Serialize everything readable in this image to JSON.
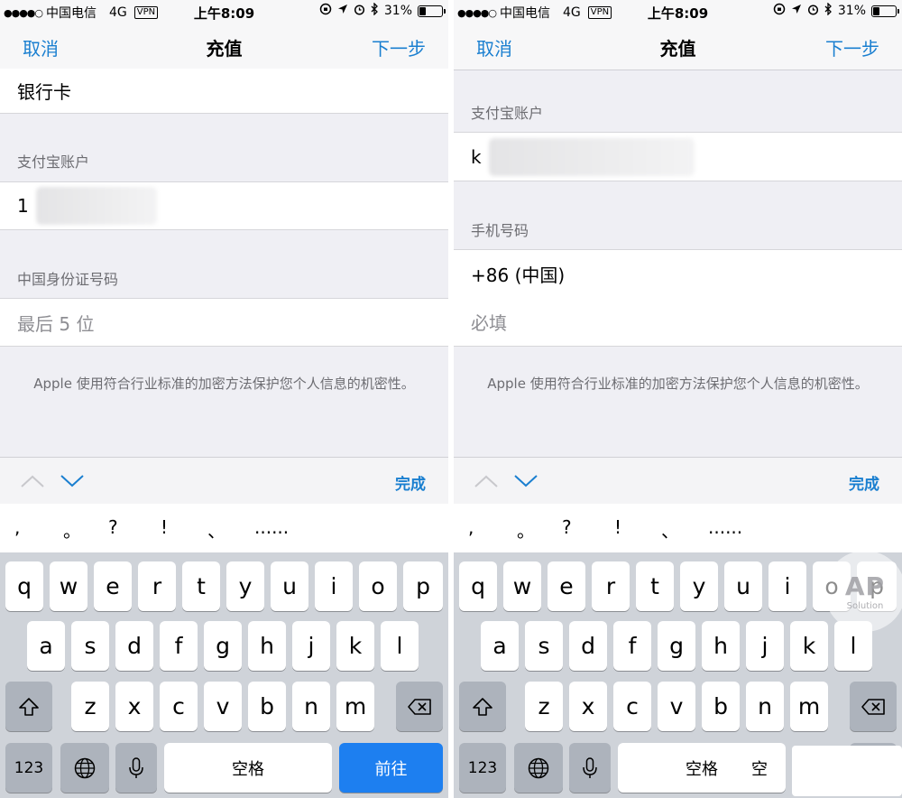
{
  "status": {
    "dots": "●●●●○",
    "carrier": "中国电信",
    "network": "4G",
    "vpn": "VPN",
    "time": "上午8:09",
    "icons": [
      "orientation-lock-icon",
      "location-icon",
      "alarm-icon",
      "bluetooth-icon"
    ],
    "battery": "31%",
    "battery_level": 0.31
  },
  "nav": {
    "cancel": "取消",
    "title": "充值",
    "next": "下一步"
  },
  "left": {
    "bank_card": "银行卡",
    "alipay_label": "支付宝账户",
    "alipay_value_prefix": "1",
    "id_label": "中国身份证号码",
    "id_placeholder": "最后 5 位",
    "note": "Apple 使用符合行业标准的加密方法保护您个人信息的机密性。"
  },
  "right": {
    "alipay_label": "支付宝账户",
    "alipay_value_prefix": "k",
    "phone_label": "手机号码",
    "country_code": "+86 (中国)",
    "phone_placeholder": "必填",
    "note": "Apple 使用符合行业标准的加密方法保护您个人信息的机密性。"
  },
  "toolbar": {
    "done": "完成"
  },
  "punctuation": [
    ",",
    "。",
    "?",
    "!",
    "、",
    "......"
  ],
  "keyboard": {
    "row1": [
      "q",
      "w",
      "e",
      "r",
      "t",
      "y",
      "u",
      "i",
      "o",
      "p"
    ],
    "row2": [
      "a",
      "s",
      "d",
      "f",
      "g",
      "h",
      "j",
      "k",
      "l"
    ],
    "row3": [
      "z",
      "x",
      "c",
      "v",
      "b",
      "n",
      "m"
    ],
    "numbers": "123",
    "space": "空格",
    "go": "前往",
    "space_partial": "空"
  },
  "watermark": {
    "line1": "AP",
    "line2": "Solution"
  }
}
